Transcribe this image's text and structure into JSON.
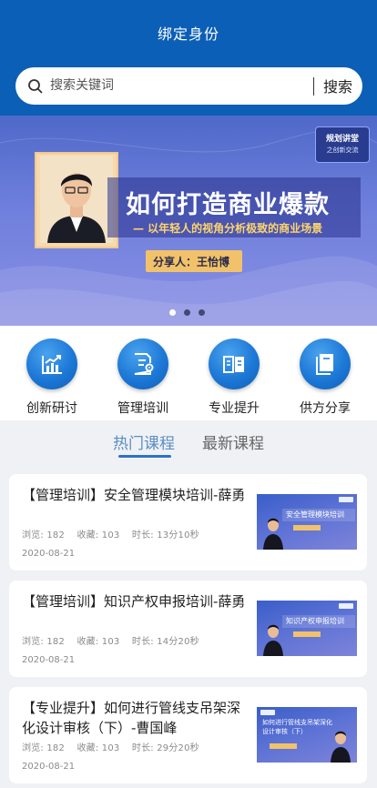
{
  "header": {
    "title": "绑定身份"
  },
  "search": {
    "placeholder": "搜索关键词",
    "button_label": "搜索"
  },
  "banner": {
    "brand_line1": "规划讲堂",
    "brand_line2": "之创新交流",
    "headline": "如何打造商业爆款",
    "subtitle": "— 以年轻人的视角分析极致的商业场景",
    "speaker": "分享人：王怡博",
    "slide_count": 3,
    "active_slide": 1
  },
  "quick_nav": [
    {
      "label": "创新研讨",
      "icon": "chart-up-icon"
    },
    {
      "label": "管理培训",
      "icon": "doc-gear-icon"
    },
    {
      "label": "专业提升",
      "icon": "open-book-icon"
    },
    {
      "label": "供方分享",
      "icon": "book-icon"
    }
  ],
  "tabs": [
    {
      "label": "热门课程",
      "active": true
    },
    {
      "label": "最新课程",
      "active": false
    }
  ],
  "courses": [
    {
      "title": "【管理培训】安全管理模块培训-薛勇",
      "views_label": "浏览: 182",
      "favorites_label": "收藏: 103",
      "duration_label": "时长: 13分10秒",
      "date": "2020-08-21",
      "thumb_text": "安全管理模块培训"
    },
    {
      "title": "【管理培训】知识产权申报培训-薛勇",
      "views_label": "浏览: 182",
      "favorites_label": "收藏: 103",
      "duration_label": "时长: 14分20秒",
      "date": "2020-08-21",
      "thumb_text": "知识产权申报培训"
    },
    {
      "title": "【专业提升】如何进行管线支吊架深化设计审核（下）-曹国峰",
      "views_label": "浏览: 182",
      "favorites_label": "收藏: 103",
      "duration_label": "时长: 29分20秒",
      "date": "2020-08-21",
      "thumb_text": "如何进行管线支吊架深化设计审核（下）"
    }
  ]
}
